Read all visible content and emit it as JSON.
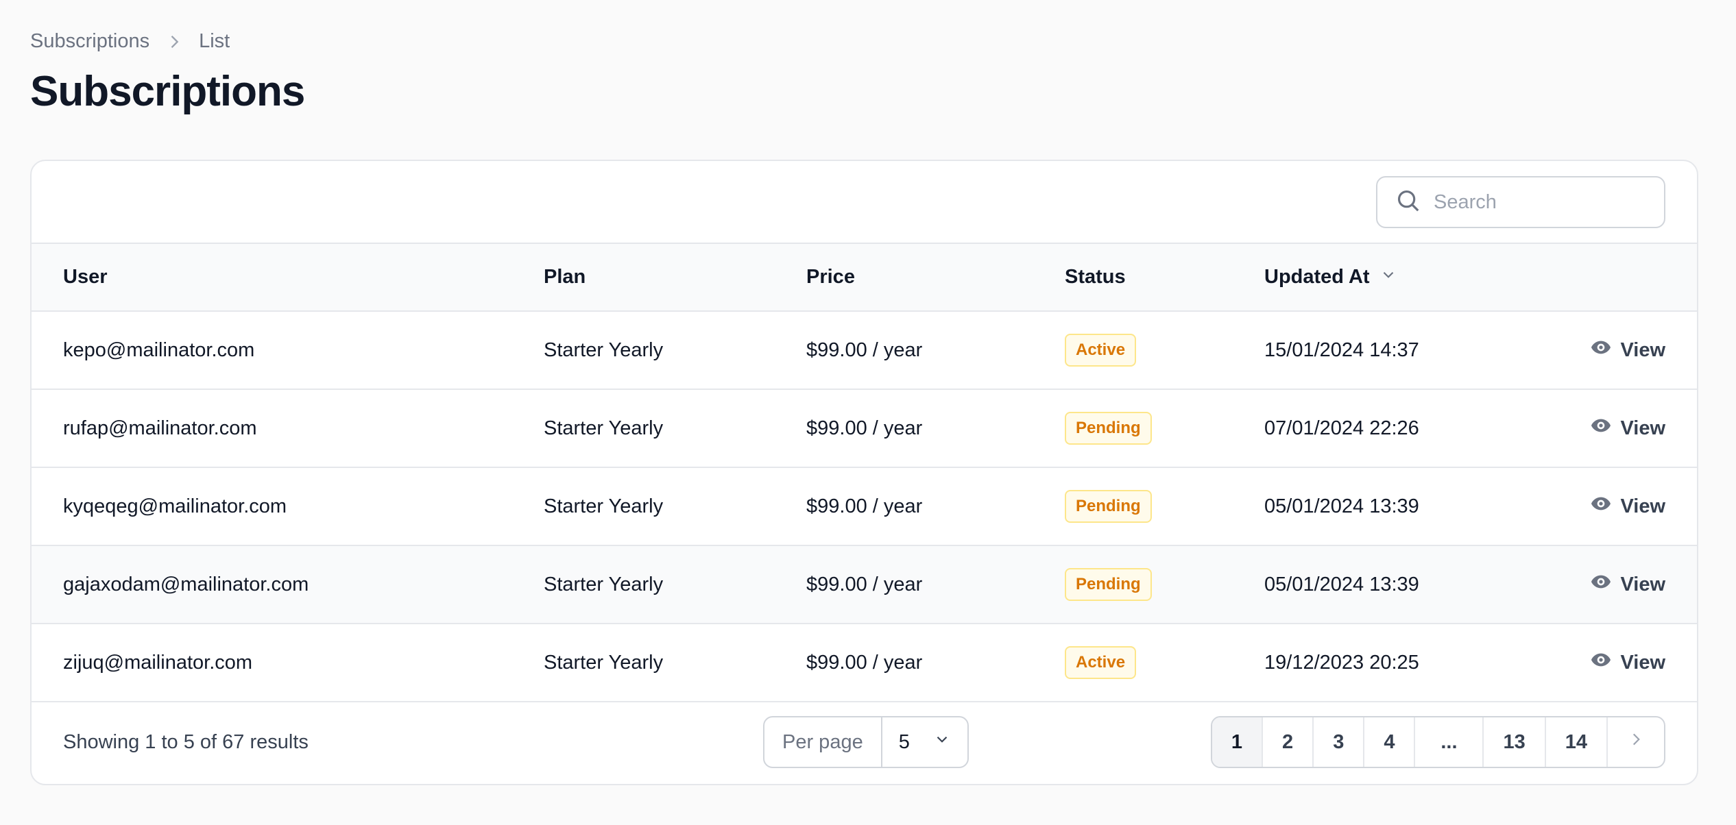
{
  "breadcrumb": {
    "parent": "Subscriptions",
    "current": "List"
  },
  "page": {
    "title": "Subscriptions"
  },
  "search": {
    "placeholder": "Search",
    "value": ""
  },
  "table": {
    "headers": {
      "user": "User",
      "plan": "Plan",
      "price": "Price",
      "status": "Status",
      "updated_at": "Updated At"
    },
    "rows": [
      {
        "user": "kepo@mailinator.com",
        "plan": "Starter Yearly",
        "price": "$99.00 / year",
        "status": "Active",
        "updated_at": "15/01/2024 14:37",
        "action": "View"
      },
      {
        "user": "rufap@mailinator.com",
        "plan": "Starter Yearly",
        "price": "$99.00 / year",
        "status": "Pending",
        "updated_at": "07/01/2024 22:26",
        "action": "View"
      },
      {
        "user": "kyqeqeg@mailinator.com",
        "plan": "Starter Yearly",
        "price": "$99.00 / year",
        "status": "Pending",
        "updated_at": "05/01/2024 13:39",
        "action": "View"
      },
      {
        "user": "gajaxodam@mailinator.com",
        "plan": "Starter Yearly",
        "price": "$99.00 / year",
        "status": "Pending",
        "updated_at": "05/01/2024 13:39",
        "action": "View"
      },
      {
        "user": "zijuq@mailinator.com",
        "plan": "Starter Yearly",
        "price": "$99.00 / year",
        "status": "Active",
        "updated_at": "19/12/2023 20:25",
        "action": "View"
      }
    ]
  },
  "footer": {
    "showing": "Showing 1 to 5 of 67 results",
    "per_page_label": "Per page",
    "per_page_value": "5",
    "pages": [
      "1",
      "2",
      "3",
      "4",
      "...",
      "13",
      "14"
    ],
    "active_page": "1"
  },
  "colors": {
    "badge_text": "#d97706",
    "badge_bg": "#fffbeb",
    "badge_border": "#fde68a"
  },
  "icons": {
    "breadcrumb_sep": "chevron-right-icon",
    "search": "search-icon",
    "sort": "chevron-down-icon",
    "view": "eye-icon",
    "next": "chevron-right-icon"
  }
}
